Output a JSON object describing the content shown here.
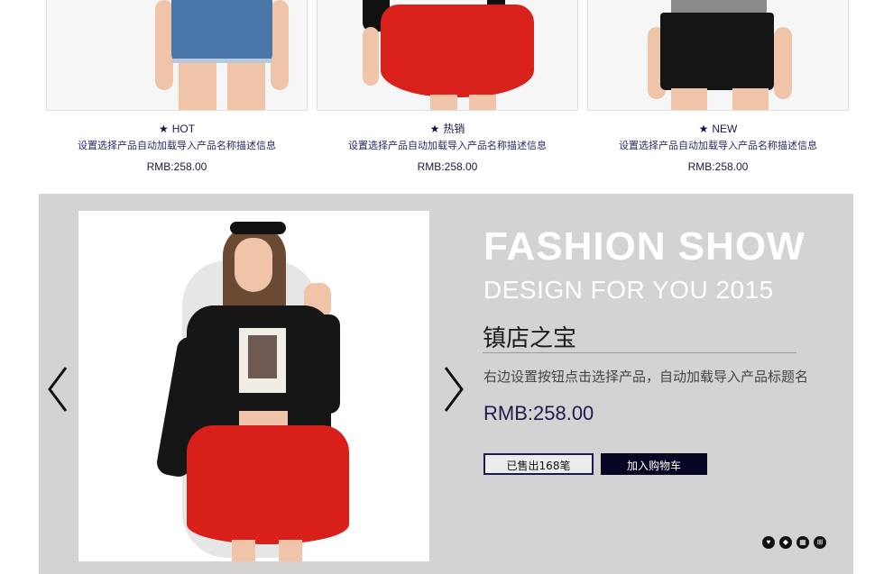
{
  "products": [
    {
      "badge": "HOT",
      "desc": "设置选择产品自动加载导入产品名称描述信息",
      "price": "RMB:258.00",
      "image": "denim-shorts"
    },
    {
      "badge": "热销",
      "desc": "设置选择产品自动加载导入产品名称描述信息",
      "price": "RMB:258.00",
      "image": "red-skirt"
    },
    {
      "badge": "NEW",
      "desc": "设置选择产品自动加载导入产品名称描述信息",
      "price": "RMB:258.00",
      "image": "black-shorts"
    }
  ],
  "feature": {
    "title": "FASHION SHOW",
    "subtitle": "DESIGN FOR YOU 2015",
    "heading": "镇店之宝",
    "description": "右边设置按钮点击选择产品，自动加载导入产品标题名",
    "price": "RMB:258.00",
    "sold_button": "已售出168笔",
    "cart_button": "加入购物车",
    "icons": [
      "heart-icon",
      "tag-icon",
      "grid-icon",
      "cart-icon"
    ],
    "colors": {
      "panel": "#d3d3d3",
      "navy": "#1a1a52",
      "cart_bg": "#060624"
    }
  }
}
